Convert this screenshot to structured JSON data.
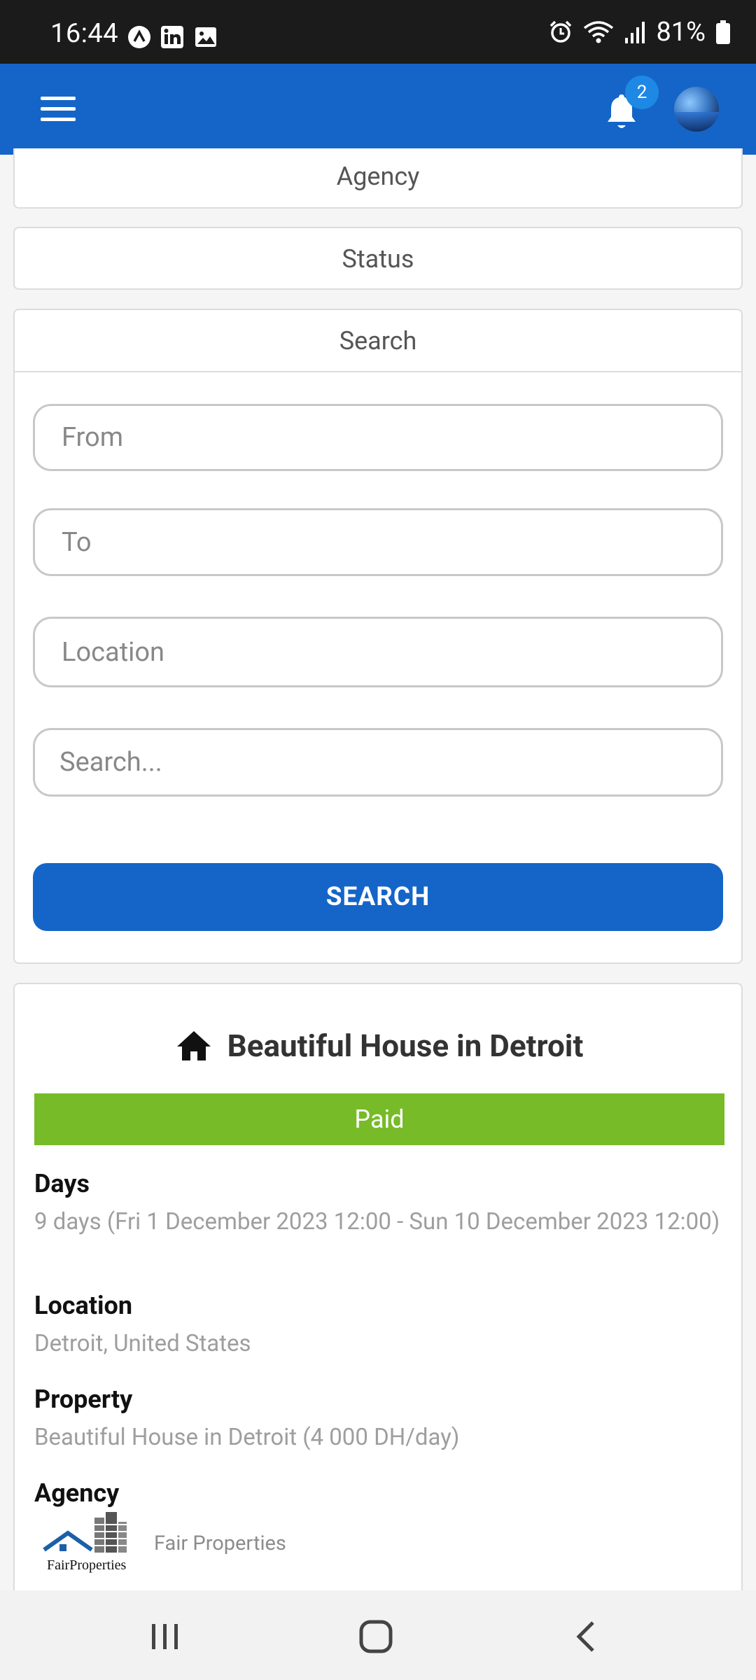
{
  "status_bar": {
    "time": "16:44",
    "battery": "81%",
    "icons": [
      "app-icon",
      "linkedin-icon",
      "gallery-icon",
      "alarm-icon",
      "wifi-icon",
      "signal-icon",
      "battery-icon"
    ]
  },
  "app_bar": {
    "menu_icon": "hamburger-icon",
    "notification_count": "2",
    "colors": {
      "primary": "#1565c8"
    }
  },
  "filters": {
    "agency_label": "Agency",
    "status_label": "Status",
    "search_label": "Search",
    "from_placeholder": "From",
    "to_placeholder": "To",
    "location_placeholder": "Location",
    "query_placeholder": "Search...",
    "search_button": "SEARCH"
  },
  "booking": {
    "title": "Beautiful House in Detroit",
    "status": "Paid",
    "status_color": "#77bb29",
    "days_label": "Days",
    "days_value": "9 days (Fri 1 December 2023 12:00 - Sun 10 December 2023 12:00)",
    "location_label": "Location",
    "location_value": "Detroit, United States",
    "property_label": "Property",
    "property_value": "Beautiful House in Detroit (4 000  DH/day)",
    "agency_label": "Agency",
    "agency_name": "Fair Properties",
    "agency_logo_text": "FairProperties"
  }
}
